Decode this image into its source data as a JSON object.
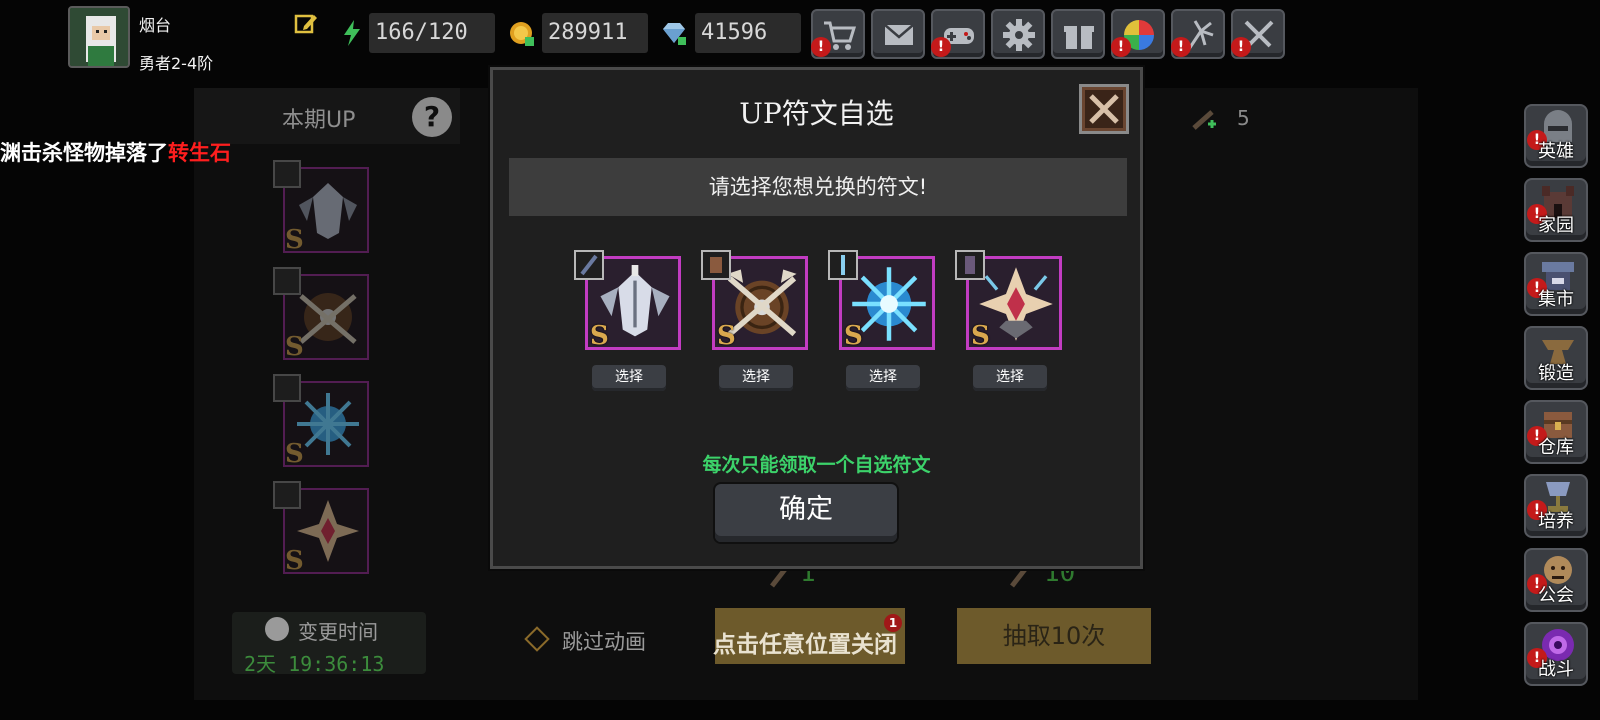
{
  "player": {
    "name": "烟台",
    "rank": "勇者2-4阶"
  },
  "resources": {
    "stamina": "166/120",
    "gold": "289911",
    "diamond": "41596"
  },
  "top_buttons": [
    {
      "icon": "cart-icon",
      "alert": "!"
    },
    {
      "icon": "mail-icon",
      "alert": ""
    },
    {
      "icon": "gamepad-icon",
      "alert": "!"
    },
    {
      "icon": "gear-icon",
      "alert": ""
    },
    {
      "icon": "gift-icon",
      "alert": ""
    },
    {
      "icon": "color-wheel-icon",
      "alert": "!"
    },
    {
      "icon": "fireworks-icon",
      "alert": "!"
    },
    {
      "icon": "crossed-swords-icon",
      "alert": "!"
    }
  ],
  "background": {
    "up_title": "本期UP",
    "help_icon": "?",
    "drop_message_prefix": "渊击杀怪物掉落了",
    "drop_message_item": "转生石",
    "rune_grade": "S",
    "timer_label": "变更时间",
    "timer_value": "2天 19:36:13",
    "skip_animation": "跳过动画",
    "close_hint": "点击任意位置关闭",
    "draw_ten": "抽取10次",
    "cost_once": "1",
    "cost_ten": "10",
    "right_count": "5"
  },
  "side_nav": [
    {
      "label": "英雄",
      "icon": "helmet-icon",
      "color": "#7a7f86"
    },
    {
      "label": "家园",
      "icon": "castle-icon",
      "color": "#5a3a36"
    },
    {
      "label": "集市",
      "icon": "market-icon",
      "color": "#5a6a8a"
    },
    {
      "label": "锻造",
      "icon": "anvil-icon",
      "color": "#8a6a3e"
    },
    {
      "label": "仓库",
      "icon": "chest-icon",
      "color": "#8a5a3e"
    },
    {
      "label": "培养",
      "icon": "chalice-icon",
      "color": "#8a7a3e"
    },
    {
      "label": "公会",
      "icon": "guild-icon",
      "color": "#b08a5a"
    },
    {
      "label": "战斗",
      "icon": "portal-icon",
      "color": "#7a2ab0"
    }
  ],
  "modal": {
    "title": "UP符文自选",
    "prompt": "请选择您想兑换的符文!",
    "runes": [
      {
        "name": "winged-shield-rune",
        "grade": "S",
        "select_label": "选择"
      },
      {
        "name": "axe-shield-rune",
        "grade": "S",
        "select_label": "选择"
      },
      {
        "name": "frost-star-rune",
        "grade": "S",
        "select_label": "选择"
      },
      {
        "name": "crystal-star-rune",
        "grade": "S",
        "select_label": "选择"
      }
    ],
    "note": "每次只能领取一个自选符文",
    "confirm_label": "确定"
  }
}
